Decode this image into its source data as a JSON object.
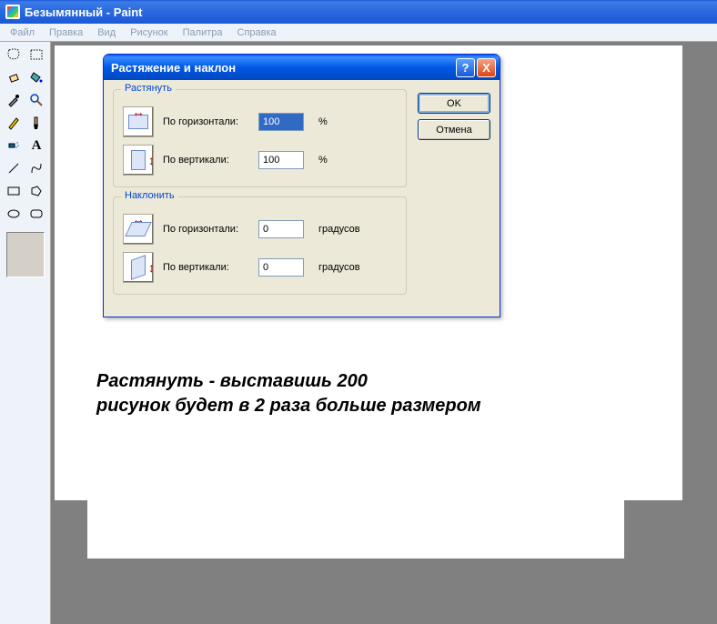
{
  "window": {
    "title": "Безымянный - Paint"
  },
  "menu": {
    "file": "Файл",
    "edit": "Правка",
    "view": "Вид",
    "image": "Рисунок",
    "palette": "Палитра",
    "help": "Справка"
  },
  "dialog": {
    "title": "Растяжение и наклон",
    "help_symbol": "?",
    "close_symbol": "X",
    "ok": "OK",
    "cancel": "Отмена",
    "stretch": {
      "legend": "Растянуть",
      "horizontal_label": "По горизонтали:",
      "horizontal_value": "100",
      "vertical_label": "По вертикали:",
      "vertical_value": "100",
      "unit": "%"
    },
    "skew": {
      "legend": "Наклонить",
      "horizontal_label": "По горизонтали:",
      "horizontal_value": "0",
      "vertical_label": "По вертикали:",
      "vertical_value": "0",
      "unit": "градусов"
    }
  },
  "canvas": {
    "note_line1": "Растянуть - выставишь 200",
    "note_line2": "рисунок будет в 2 раза больше размером"
  }
}
